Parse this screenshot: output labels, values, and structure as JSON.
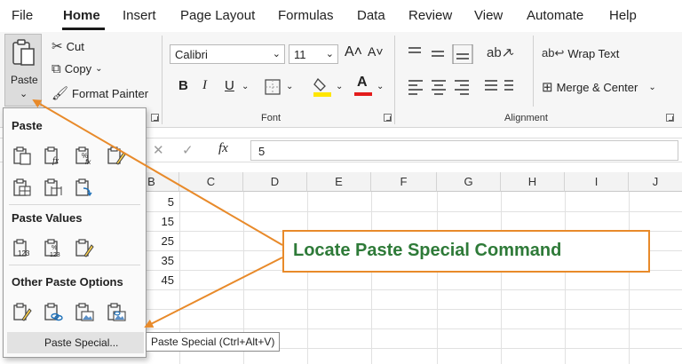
{
  "tabs": [
    "File",
    "Home",
    "Insert",
    "Page Layout",
    "Formulas",
    "Data",
    "Review",
    "View",
    "Automate",
    "Help"
  ],
  "clipboard": {
    "paste_label": "Paste",
    "cut_label": "Cut",
    "copy_label": "Copy",
    "format_painter_label": "Format Painter"
  },
  "font": {
    "font_name": "Calibri",
    "font_size": "11",
    "group_label": "Font"
  },
  "alignment": {
    "wrap_text_label": "Wrap Text",
    "merge_center_label": "Merge & Center",
    "group_label": "Alignment"
  },
  "formula_bar": {
    "fx_label": "fx",
    "value": "5"
  },
  "grid": {
    "columns": [
      "B",
      "C",
      "D",
      "E",
      "F",
      "G",
      "H",
      "I",
      "J"
    ],
    "column_b_values": [
      "5",
      "15",
      "25",
      "35",
      "45"
    ]
  },
  "paste_menu": {
    "paste_header": "Paste",
    "paste_values_header": "Paste Values",
    "other_options_header": "Other Paste Options",
    "paste_special_label": "Paste Special...",
    "tooltip": "Paste Special (Ctrl+Alt+V)"
  },
  "callout": {
    "text": "Locate Paste Special Command"
  },
  "colors": {
    "callout_border": "#e88a2a",
    "callout_text": "#2e7a38",
    "arrow": "#e88a2a"
  }
}
